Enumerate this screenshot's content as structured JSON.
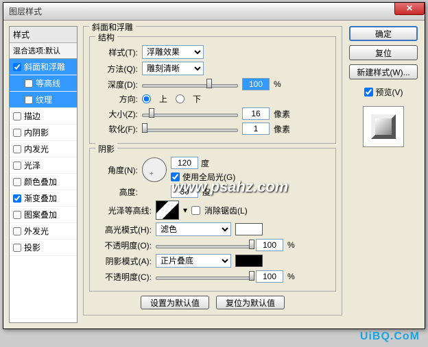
{
  "window": {
    "title": "图层样式"
  },
  "left": {
    "header": "样式",
    "sub": "混合选项:默认",
    "items": [
      {
        "label": "斜面和浮雕",
        "checked": true,
        "selected": true
      },
      {
        "label": "等高线",
        "checked": false,
        "selected": true,
        "sub": true
      },
      {
        "label": "纹理",
        "checked": false,
        "selected": true,
        "sub": true
      },
      {
        "label": "描边",
        "checked": false
      },
      {
        "label": "内阴影",
        "checked": false
      },
      {
        "label": "内发光",
        "checked": false
      },
      {
        "label": "光泽",
        "checked": false
      },
      {
        "label": "颜色叠加",
        "checked": false
      },
      {
        "label": "渐变叠加",
        "checked": true
      },
      {
        "label": "图案叠加",
        "checked": false
      },
      {
        "label": "外发光",
        "checked": false
      },
      {
        "label": "投影",
        "checked": false
      }
    ]
  },
  "bevel": {
    "group_title": "斜面和浮雕",
    "structure_title": "结构",
    "style_label": "样式(T):",
    "style_value": "浮雕效果",
    "method_label": "方法(Q):",
    "method_value": "雕刻清晰",
    "depth_label": "深度(D):",
    "depth_value": "100",
    "depth_pct": 70,
    "direction_label": "方向:",
    "up": "上",
    "down": "下",
    "size_label": "大小(Z):",
    "size_value": "16",
    "size_unit": "像素",
    "size_pct": 10,
    "soften_label": "软化(F):",
    "soften_value": "1",
    "soften_unit": "像素",
    "soften_pct": 3,
    "percent": "%"
  },
  "shadow": {
    "group_title": "阴影",
    "angle_label": "角度(N):",
    "angle_value": "120",
    "degree": "度",
    "global_label": "使用全局光(G)",
    "altitude_label": "高度:",
    "altitude_value": "30",
    "gloss_label": "光泽等高线:",
    "antialias": "消除锯齿(L)",
    "hilite_mode_label": "高光模式(H):",
    "hilite_mode_value": "滤色",
    "opacity_label": "不透明度(O):",
    "opacity_value": "100",
    "shadow_mode_label": "阴影模式(A):",
    "shadow_mode_value": "正片叠底",
    "opacity2_label": "不透明度(C):",
    "opacity2_value": "100"
  },
  "buttons": {
    "ok": "确定",
    "cancel": "复位",
    "new_style": "新建样式(W)...",
    "preview": "预览(V)",
    "set_default": "设置为默认值",
    "reset_default": "复位为默认值"
  },
  "watermark": "www.psahz.com",
  "watermark2": "UiBQ.CoM"
}
